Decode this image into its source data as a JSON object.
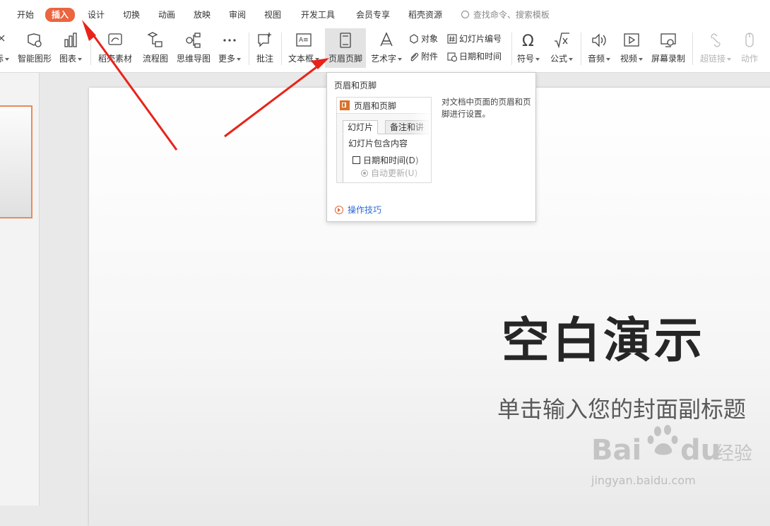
{
  "menu": {
    "tabs": [
      {
        "id": "start",
        "label": "开始"
      },
      {
        "id": "insert",
        "label": "插入",
        "active": true
      },
      {
        "id": "design",
        "label": "设计"
      },
      {
        "id": "transition",
        "label": "切换"
      },
      {
        "id": "animation",
        "label": "动画"
      },
      {
        "id": "slideshow",
        "label": "放映"
      },
      {
        "id": "review",
        "label": "审阅"
      },
      {
        "id": "view",
        "label": "视图"
      },
      {
        "id": "developer",
        "label": "开发工具"
      },
      {
        "id": "member",
        "label": "会员专享"
      },
      {
        "id": "resource",
        "label": "稻壳资源"
      }
    ],
    "search_placeholder": "查找命令、搜索模板",
    "active_color": "#ea6540"
  },
  "ribbon": {
    "cut_label": "标",
    "smartart": "智能图形",
    "chart": "图表",
    "docer_material": "稻壳素材",
    "flowchart": "流程图",
    "mindmap": "思维导图",
    "more": "更多",
    "comment": "批注",
    "textbox": "文本框",
    "header_footer": "页眉页脚",
    "wordart": "艺术字",
    "object": "对象",
    "slide_number": "幻灯片编号",
    "attachment": "附件",
    "date_time": "日期和时间",
    "symbol": "符号",
    "formula": "公式",
    "audio": "音频",
    "video": "视频",
    "screen_record": "屏幕录制",
    "hyperlink": "超链接",
    "action": "动作"
  },
  "tooltip": {
    "title": "页眉和页脚",
    "preview": {
      "dialog_title": "页眉和页脚",
      "tab_slide": "幻灯片",
      "tab_notes": "备注和讲",
      "group_label": "幻灯片包含内容",
      "date_checkbox": "日期和时间(D)",
      "auto_update": "自动更新(U)"
    },
    "description": "对文档中页面的页眉和页脚进行设置。",
    "tips_link": "操作技巧"
  },
  "slide": {
    "title": "空白演示",
    "subtitle": "单击输入您的封面副标题"
  },
  "watermark": {
    "brand_latin": "Bai",
    "brand_latin_end": "du",
    "brand_cn": "经验",
    "url": "jingyan.baidu.com"
  },
  "annotation_color": "#e8231a"
}
